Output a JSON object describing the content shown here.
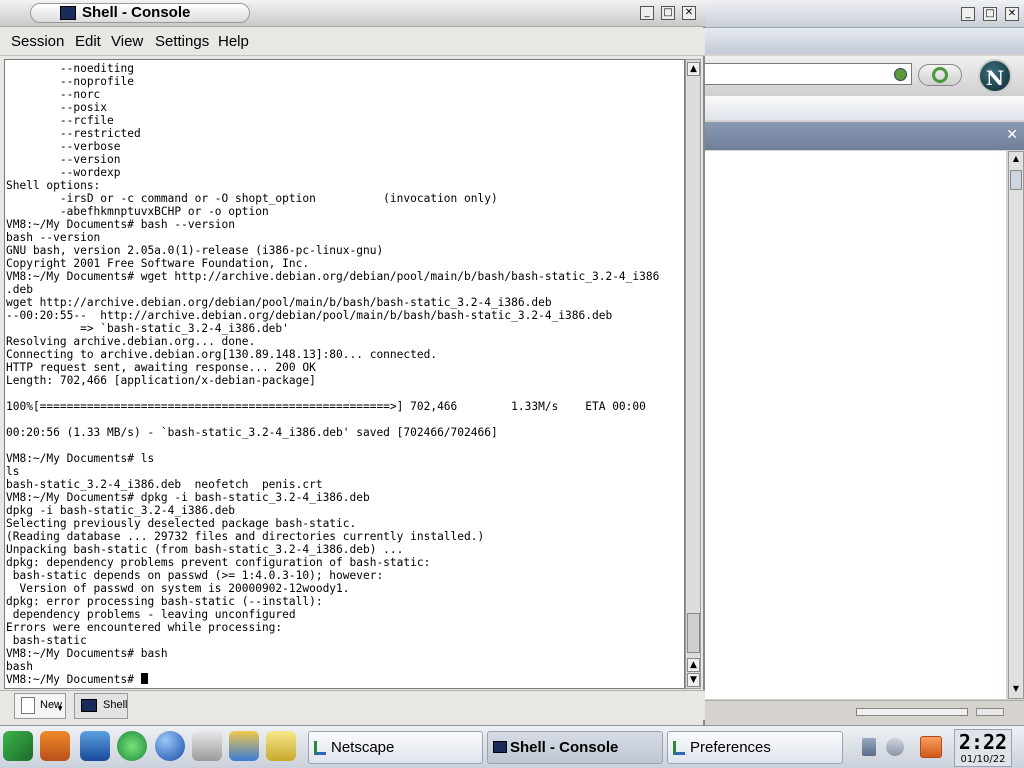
{
  "console": {
    "title": "Shell - Console",
    "menu": [
      "Session",
      "Edit",
      "View",
      "Settings",
      "Help"
    ],
    "terminal_lines": [
      "        --noediting",
      "        --noprofile",
      "        --norc",
      "        --posix",
      "        --rcfile",
      "        --restricted",
      "        --verbose",
      "        --version",
      "        --wordexp",
      "Shell options:",
      "        -irsD or -c command or -O shopt_option          (invocation only)",
      "        -abefhkmnptuvxBCHP or -o option",
      "VM8:~/My Documents# bash --version",
      "bash --version",
      "GNU bash, version 2.05a.0(1)-release (i386-pc-linux-gnu)",
      "Copyright 2001 Free Software Foundation, Inc.",
      "VM8:~/My Documents# wget http://archive.debian.org/debian/pool/main/b/bash/bash-static_3.2-4_i386",
      ".deb",
      "wget http://archive.debian.org/debian/pool/main/b/bash/bash-static_3.2-4_i386.deb",
      "--00:20:55--  http://archive.debian.org/debian/pool/main/b/bash/bash-static_3.2-4_i386.deb",
      "           => `bash-static_3.2-4_i386.deb'",
      "Resolving archive.debian.org... done.",
      "Connecting to archive.debian.org[130.89.148.13]:80... connected.",
      "HTTP request sent, awaiting response... 200 OK",
      "Length: 702,466 [application/x-debian-package]",
      "",
      "100%[====================================================>] 702,466        1.33M/s    ETA 00:00",
      "",
      "00:20:56 (1.33 MB/s) - `bash-static_3.2-4_i386.deb' saved [702466/702466]",
      "",
      "VM8:~/My Documents# ls",
      "ls",
      "bash-static_3.2-4_i386.deb  neofetch  penis.crt",
      "VM8:~/My Documents# dpkg -i bash-static_3.2-4_i386.deb",
      "dpkg -i bash-static_3.2-4_i386.deb",
      "Selecting previously deselected package bash-static.",
      "(Reading database ... 29732 files and directories currently installed.)",
      "Unpacking bash-static (from bash-static_3.2-4_i386.deb) ...",
      "dpkg: dependency problems prevent configuration of bash-static:",
      " bash-static depends on passwd (>= 1:4.0.3-10); however:",
      "  Version of passwd on system is 20000902-12woody1.",
      "dpkg: error processing bash-static (--install):",
      " dependency problems - leaving unconfigured",
      "Errors were encountered while processing:",
      " bash-static",
      "VM8:~/My Documents# bash",
      "bash"
    ],
    "prompt": "VM8:~/My Documents# ",
    "tabs": {
      "new_label": "New",
      "shell_label": "Shell"
    }
  },
  "taskbar": {
    "tasks": [
      "Netscape",
      "Shell - Console",
      "Preferences"
    ],
    "clock_time": "2:22",
    "clock_date": "01/10/22"
  },
  "colors": {
    "accent": "#2f6db0",
    "terminal_bg": "#ffffff",
    "panel": "#d6d3ce"
  }
}
